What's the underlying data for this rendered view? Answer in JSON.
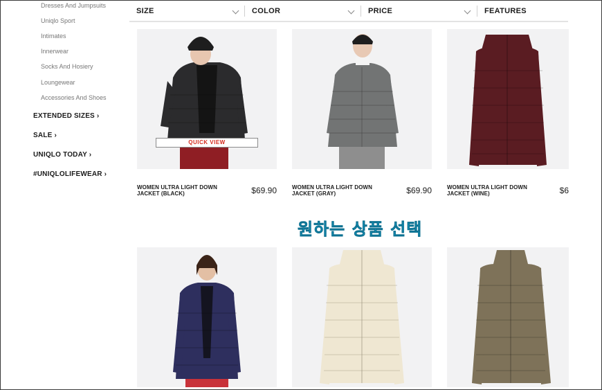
{
  "sidebar": {
    "sub_items": [
      {
        "label": "Dresses And Jumpsuits"
      },
      {
        "label": "Uniqlo Sport"
      },
      {
        "label": "Intimates"
      },
      {
        "label": "Innerwear"
      },
      {
        "label": "Socks And Hosiery"
      },
      {
        "label": "Loungewear"
      },
      {
        "label": "Accessories And Shoes"
      }
    ],
    "main_links": [
      {
        "label": "EXTENDED SIZES ›"
      },
      {
        "label": "SALE ›"
      },
      {
        "label": "UNIQLO TODAY ›"
      },
      {
        "label": "#UNIQLOLIFEWEAR ›"
      }
    ]
  },
  "filters": [
    {
      "label": "SIZE"
    },
    {
      "label": "COLOR"
    },
    {
      "label": "PRICE"
    },
    {
      "label": "FEATURES"
    }
  ],
  "products": [
    {
      "name": "WOMEN ULTRA LIGHT DOWN JACKET (BLACK)",
      "price": "$69.90",
      "jacket_color": "#2b2b2d",
      "quick_view": "QUICK VIEW"
    },
    {
      "name": "WOMEN ULTRA LIGHT DOWN JACKET (GRAY)",
      "price": "$69.90",
      "jacket_color": "#727474"
    },
    {
      "name": "WOMEN ULTRA LIGHT DOWN JACKET (WINE)",
      "price": "$6",
      "jacket_color": "#5a1c22"
    },
    {
      "jacket_color": "#2e2f5e"
    },
    {
      "jacket_color": "#efe7d2"
    },
    {
      "jacket_color": "#7e7259"
    }
  ],
  "overlay_caption": "원하는 상품 선택",
  "colors": {
    "accent_red": "#d52b1e",
    "overlay_cyan": "#1fb3de"
  }
}
